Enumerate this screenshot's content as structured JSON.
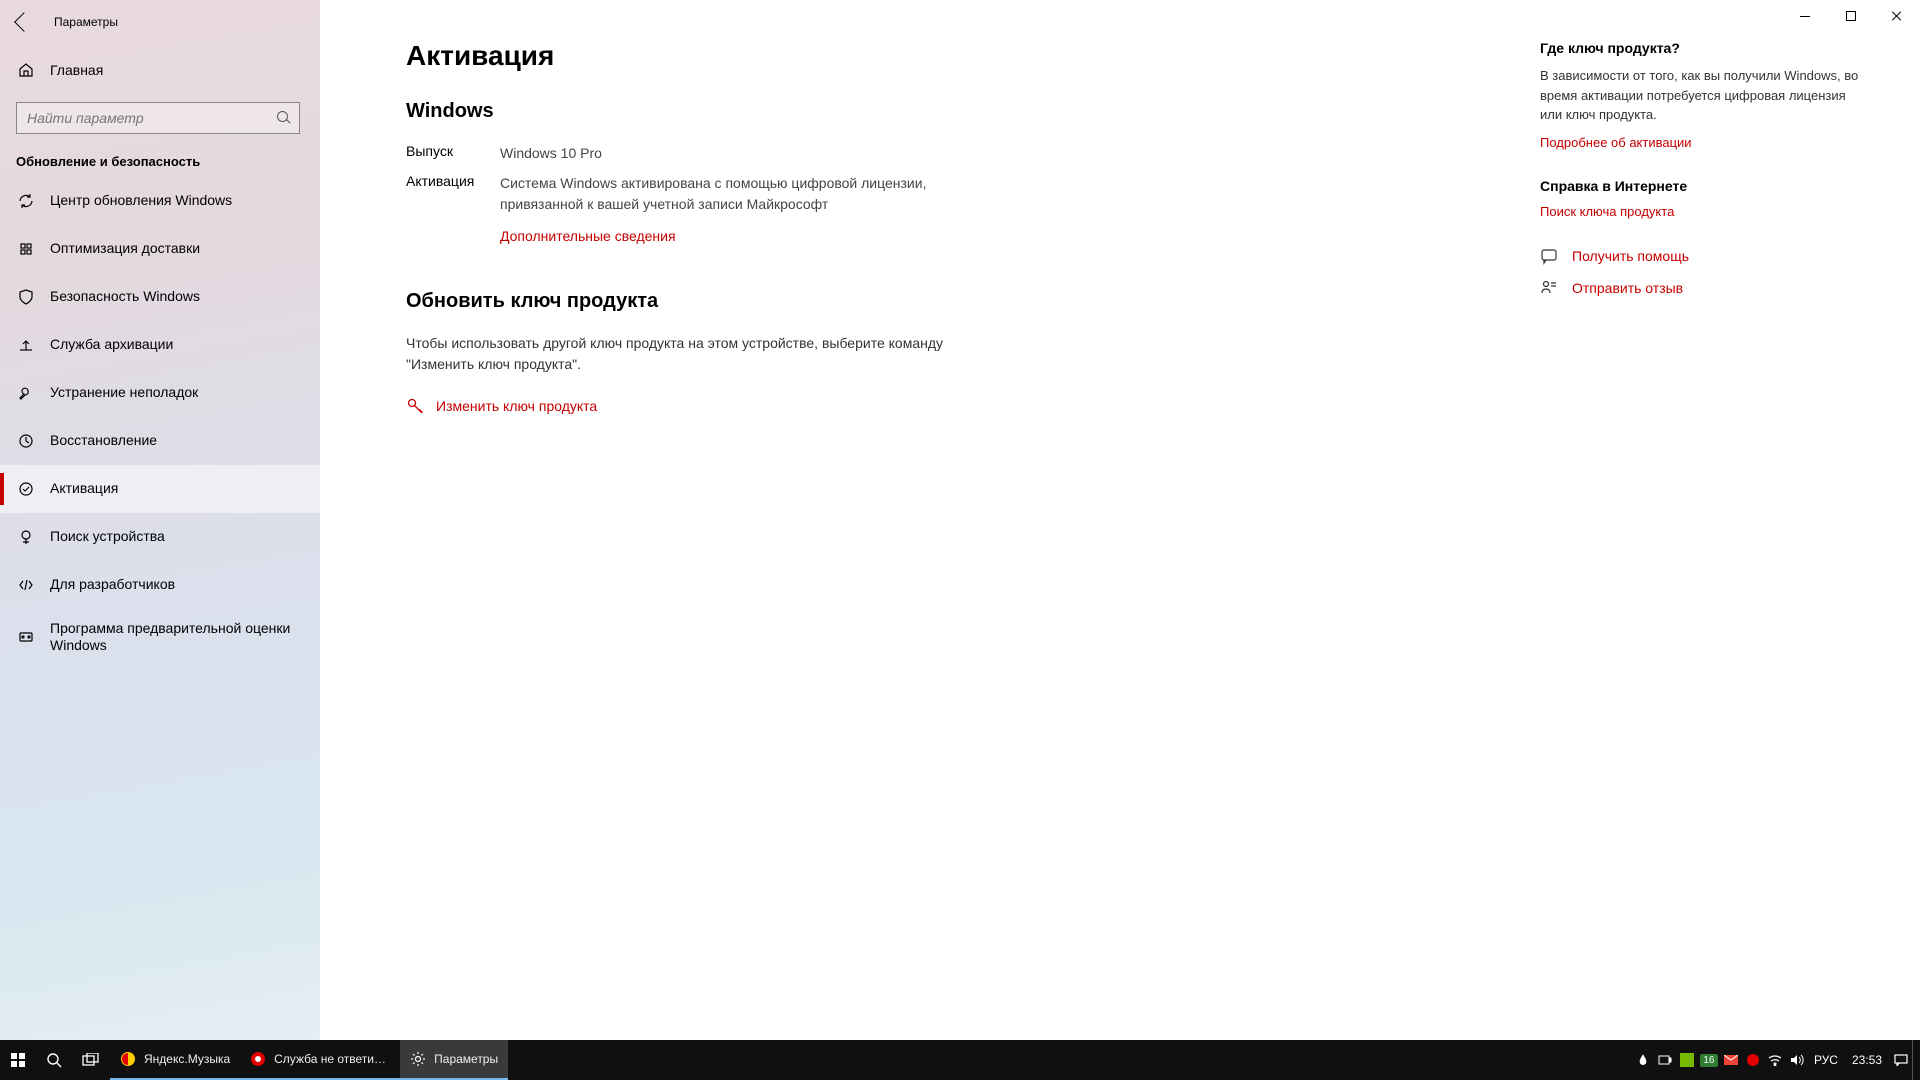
{
  "window": {
    "title": "Параметры"
  },
  "sidebar": {
    "home": "Главная",
    "search_placeholder": "Найти параметр",
    "section": "Обновление и безопасность",
    "items": [
      {
        "label": "Центр обновления Windows"
      },
      {
        "label": "Оптимизация доставки"
      },
      {
        "label": "Безопасность Windows"
      },
      {
        "label": "Служба архивации"
      },
      {
        "label": "Устранение неполадок"
      },
      {
        "label": "Восстановление"
      },
      {
        "label": "Активация"
      },
      {
        "label": "Поиск устройства"
      },
      {
        "label": "Для разработчиков"
      },
      {
        "label": "Программа предварительной оценки Windows"
      }
    ]
  },
  "main": {
    "title": "Активация",
    "section1": "Windows",
    "edition_label": "Выпуск",
    "edition_value": "Windows 10 Pro",
    "activation_label": "Активация",
    "activation_value": "Система Windows активирована с помощью цифровой лицензии, привязанной к вашей учетной записи Майкрософт",
    "more_info": "Дополнительные сведения",
    "section2": "Обновить ключ продукта",
    "update_text": "Чтобы использовать другой ключ продукта на этом устройстве, выберите команду \"Изменить ключ продукта\".",
    "change_key": "Изменить ключ продукта"
  },
  "right": {
    "h1": "Где ключ продукта?",
    "t1": "В зависимости от того, как вы получили Windows, во время активации потребуется цифровая лицензия или ключ продукта.",
    "l1": "Подробнее об активации",
    "h2": "Справка в Интернете",
    "l2": "Поиск ключа продукта",
    "help": "Получить помощь",
    "feedback": "Отправить отзыв"
  },
  "taskbar": {
    "apps": [
      {
        "label": "Яндекс.Музыка"
      },
      {
        "label": "Служба не ответила ..."
      },
      {
        "label": "Параметры"
      }
    ],
    "tray": {
      "badge": "16",
      "lang": "РУС",
      "time": "23:53"
    }
  }
}
